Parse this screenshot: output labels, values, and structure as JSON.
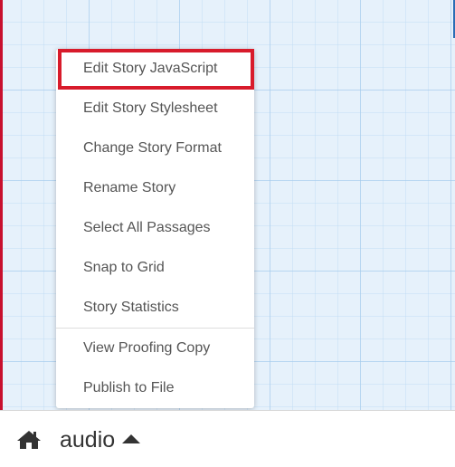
{
  "menu": {
    "items": [
      {
        "label": "Edit Story JavaScript"
      },
      {
        "label": "Edit Story Stylesheet"
      },
      {
        "label": "Change Story Format"
      },
      {
        "label": "Rename Story"
      },
      {
        "label": "Select All Passages"
      },
      {
        "label": "Snap to Grid"
      },
      {
        "label": "Story Statistics"
      }
    ],
    "secondary_items": [
      {
        "label": "View Proofing Copy"
      },
      {
        "label": "Publish to File"
      }
    ]
  },
  "footer": {
    "home_icon": "home-icon",
    "story_name": "audio",
    "caret_icon": "caret-up-icon"
  },
  "colors": {
    "highlight": "#d81b2b",
    "canvas": "#e6f1fb",
    "text": "#555555"
  }
}
